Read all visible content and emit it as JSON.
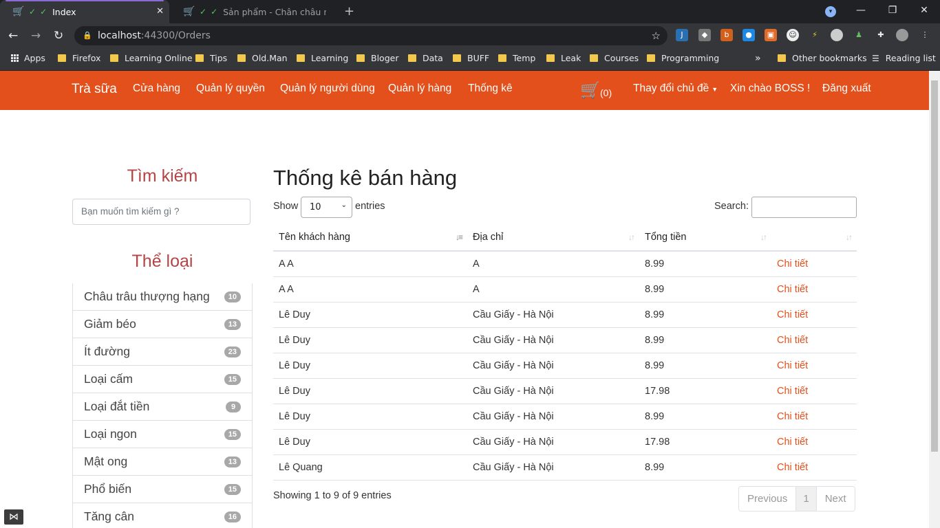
{
  "tabs": [
    {
      "title": "Index",
      "active": true
    },
    {
      "title": "Sản phẩm - Chân châu nư",
      "active": false
    }
  ],
  "address": {
    "host": "localhost",
    "port_path": ":44300/Orders"
  },
  "bookmarks": [
    "Apps",
    "Firefox",
    "Learning Online",
    "Tips",
    "Old.Man",
    "Learning",
    "Bloger",
    "Data",
    "BUFF",
    "Temp",
    "Leak",
    "Courses",
    "Programming"
  ],
  "bookmarks_more": "»",
  "other_bookmarks": "Other bookmarks",
  "reading_list": "Reading list",
  "navbar": {
    "brand": "Trà sữa",
    "items": [
      "Cửa hàng",
      "Quản lý quyền",
      "Quản lý người dùng",
      "Quản lý hàng",
      "Thống kê"
    ],
    "cart_count": "(0)",
    "theme": "Thay đổi chủ đề",
    "greeting": "Xin chào BOSS !",
    "logout": "Đăng xuất"
  },
  "sidebar": {
    "search_title": "Tìm kiếm",
    "search_placeholder": "Bạn muốn tìm kiếm gì ?",
    "category_title": "Thể loại",
    "categories": [
      {
        "name": "Châu trâu thượng hạng",
        "count": "10"
      },
      {
        "name": "Giảm béo",
        "count": "13"
      },
      {
        "name": "Ít đường",
        "count": "23"
      },
      {
        "name": "Loại cấm",
        "count": "15"
      },
      {
        "name": "Loại đắt tiền",
        "count": "9"
      },
      {
        "name": "Loại ngon",
        "count": "15"
      },
      {
        "name": "Mật ong",
        "count": "13"
      },
      {
        "name": "Phổ biến",
        "count": "15"
      },
      {
        "name": "Tăng cân",
        "count": "16"
      }
    ]
  },
  "main": {
    "title": "Thống kê bán hàng",
    "show_label": "Show",
    "page_size": "10",
    "entries_label": "entries",
    "search_label": "Search:",
    "columns": [
      "Tên khách hàng",
      "Địa chỉ",
      "Tổng tiền",
      ""
    ],
    "rows": [
      {
        "name": "A A",
        "address": "A",
        "total": "8.99",
        "action": "Chi tiết"
      },
      {
        "name": "A A",
        "address": "A",
        "total": "8.99",
        "action": "Chi tiết"
      },
      {
        "name": "Lê Duy",
        "address": "Cầu Giấy - Hà Nội",
        "total": "8.99",
        "action": "Chi tiết"
      },
      {
        "name": "Lê Duy",
        "address": "Cầu Giấy - Hà Nội",
        "total": "8.99",
        "action": "Chi tiết"
      },
      {
        "name": "Lê Duy",
        "address": "Cầu Giấy - Hà Nội",
        "total": "8.99",
        "action": "Chi tiết"
      },
      {
        "name": "Lê Duy",
        "address": "Cầu Giấy - Hà Nội",
        "total": "17.98",
        "action": "Chi tiết"
      },
      {
        "name": "Lê Duy",
        "address": "Cầu Giấy - Hà Nội",
        "total": "8.99",
        "action": "Chi tiết"
      },
      {
        "name": "Lê Duy",
        "address": "Cầu Giấy - Hà Nội",
        "total": "17.98",
        "action": "Chi tiết"
      },
      {
        "name": "Lê Quang",
        "address": "Cầu Giấy - Hà Nội",
        "total": "8.99",
        "action": "Chi tiết"
      }
    ],
    "info": "Showing 1 to 9 of 9 entries",
    "pager": {
      "prev": "Previous",
      "current": "1",
      "next": "Next"
    }
  },
  "colors": {
    "accent": "#e4501b",
    "heading": "#b54444"
  }
}
